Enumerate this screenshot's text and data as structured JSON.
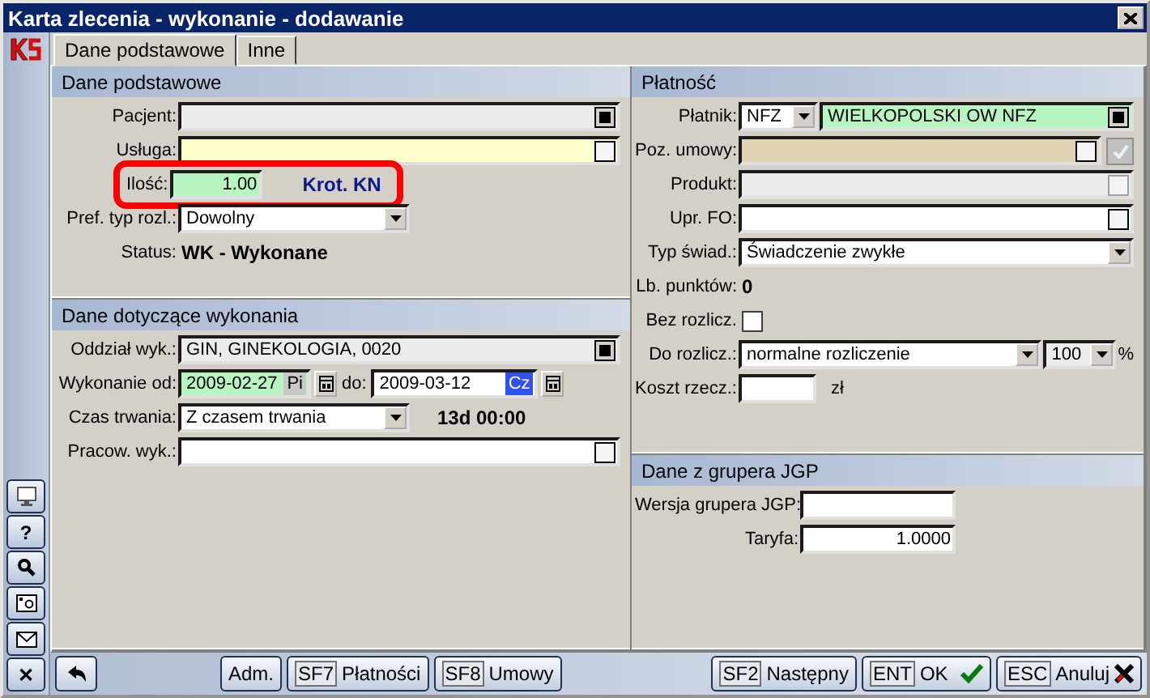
{
  "window": {
    "title": "Karta zlecenia - wykonanie - dodawanie"
  },
  "tabs": [
    {
      "label": "Dane podstawowe",
      "selected": true
    },
    {
      "label": "Inne",
      "selected": false
    }
  ],
  "sidebar_buttons": [
    {
      "kind": "monitor"
    },
    {
      "kind": "text",
      "label": "?"
    },
    {
      "kind": "search"
    },
    {
      "kind": "photo"
    },
    {
      "kind": "mail"
    },
    {
      "kind": "text",
      "label": "✕"
    }
  ],
  "left_sections": [
    {
      "title": "Dane podstawowe",
      "rows": [
        {
          "kind": "lookup",
          "label": "Pacjent:",
          "color": "#ececec",
          "readonly": true,
          "disabled": false
        },
        {
          "kind": "lookup",
          "label": "Usługa:",
          "color": "#ffffcc",
          "readonly": false,
          "disabled": false
        },
        {
          "kind": "quantity",
          "label": "Ilość:",
          "value": "1.00",
          "unit": "Krot. KN",
          "highlighted": true
        },
        {
          "kind": "select",
          "label": "Pref. typ rozl.:",
          "value": "Dowolny"
        },
        {
          "kind": "info",
          "label": "Status:",
          "value": "WK - Wykonane"
        }
      ]
    },
    {
      "title": "Dane dotyczące wykonania",
      "rows": [
        {
          "kind": "lookup",
          "label": "Oddział wyk.:",
          "value": "GIN, GINEKOLOGIA, 0020",
          "color": "#ececec",
          "readonly": true,
          "disabled": false
        },
        {
          "kind": "dates",
          "label": "Wykonanie od:",
          "from": {
            "value": "2009-02-27",
            "color": "#b8f5c0",
            "day": "Pi",
            "day_selected": false
          },
          "to_label": "do:",
          "to": {
            "value": "2009-03-12",
            "color": "#ffffff",
            "day": "Cz",
            "day_selected": true
          }
        },
        {
          "kind": "select",
          "label": "Czas trwania:",
          "value": "Z czasem trwania",
          "note": "13d 00:00"
        },
        {
          "kind": "lookup",
          "label": "Pracow. wyk.:",
          "color": "#ffffff",
          "readonly": false,
          "disabled": false
        }
      ]
    }
  ],
  "right_sections": [
    {
      "title": "Płatność",
      "rows": [
        {
          "kind": "payer",
          "label": "Płatnik:",
          "code": "NFZ",
          "value": "WIELKOPOLSKI OW NFZ",
          "color": "#b8f5c0",
          "readonly": true,
          "disabled": false
        },
        {
          "kind": "lookup",
          "label": "Poz. umowy:",
          "color": "#e0d4b4",
          "readonly": false,
          "disabled": false,
          "confirm_disabled": true
        },
        {
          "kind": "lookup",
          "label": "Produkt:",
          "color": "#ececec",
          "readonly": false,
          "disabled": true
        },
        {
          "kind": "lookup",
          "label": "Upr. FO:",
          "color": "#ffffff",
          "readonly": false,
          "disabled": false
        },
        {
          "kind": "select",
          "label": "Typ świad.:",
          "value": "Świadczenie zwykłe"
        },
        {
          "kind": "info",
          "label": "Lb. punktów:",
          "value": "0"
        },
        {
          "kind": "checkbox",
          "label": "Bez rozlicz.",
          "checked": false
        },
        {
          "kind": "split_select",
          "label": "Do rozlicz.:",
          "value": "normalne rozliczenie",
          "percent": "100",
          "suffix": "%"
        },
        {
          "kind": "amount",
          "label": "Koszt rzecz.:",
          "unit": "zł"
        }
      ]
    },
    {
      "title": "Dane z grupera JGP",
      "rows": [
        {
          "kind": "text",
          "label": "Wersja grupera JGP:"
        },
        {
          "kind": "text",
          "label": "Taryfa:",
          "value": "1.0000"
        }
      ]
    }
  ],
  "bottom_bar": {
    "left": [
      {
        "kind": "back"
      },
      {
        "kind": "plain",
        "label": "Adm."
      },
      {
        "kind": "key",
        "key": "SF7",
        "label": "Płatności"
      },
      {
        "kind": "key",
        "key": "SF8",
        "label": "Umowy"
      }
    ],
    "right": [
      {
        "kind": "key",
        "key": "SF2",
        "label": "Następny"
      },
      {
        "kind": "confirm",
        "key": "ENT",
        "label": "OK"
      },
      {
        "kind": "cancel",
        "key": "ESC",
        "label": "Anuluj"
      }
    ]
  }
}
